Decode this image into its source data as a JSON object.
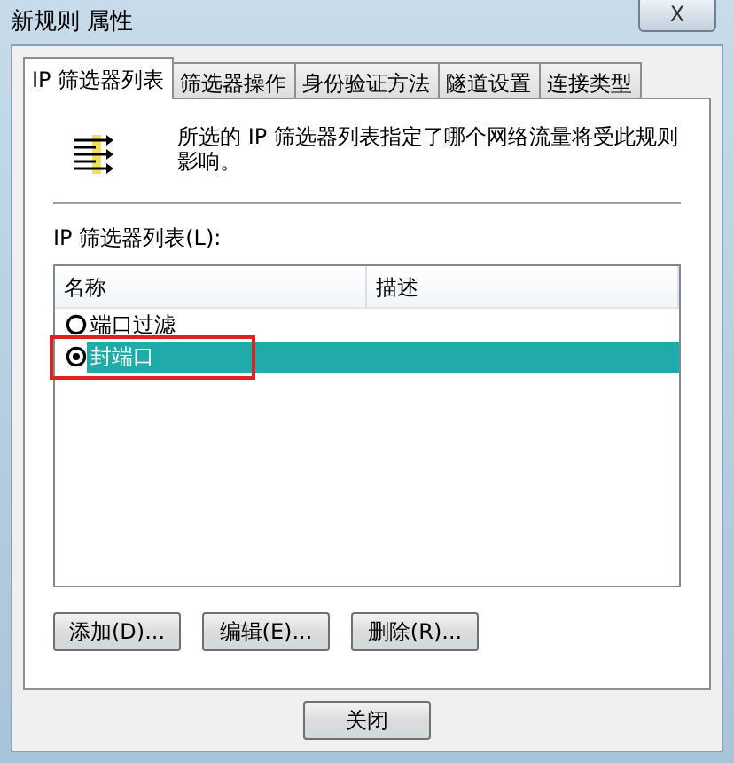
{
  "window": {
    "title": "新规则 属性",
    "close": "X"
  },
  "tabs": [
    {
      "label": "IP 筛选器列表",
      "selected": true
    },
    {
      "label": "筛选器操作",
      "selected": false
    },
    {
      "label": "身份验证方法",
      "selected": false
    },
    {
      "label": "隧道设置",
      "selected": false
    },
    {
      "label": "连接类型",
      "selected": false
    }
  ],
  "description": "所选的 IP 筛选器列表指定了哪个网络流量将受此规则影响。",
  "list_label": "IP 筛选器列表(L):",
  "list": {
    "columns": [
      "名称",
      "描述"
    ],
    "rows": [
      {
        "name": "端口过滤",
        "selected": false
      },
      {
        "name": "封端口",
        "selected": true
      }
    ]
  },
  "buttons": [
    "添加(D)...",
    "编辑(E)...",
    "删除(R)..."
  ],
  "footer_buttons": [
    "关闭"
  ]
}
